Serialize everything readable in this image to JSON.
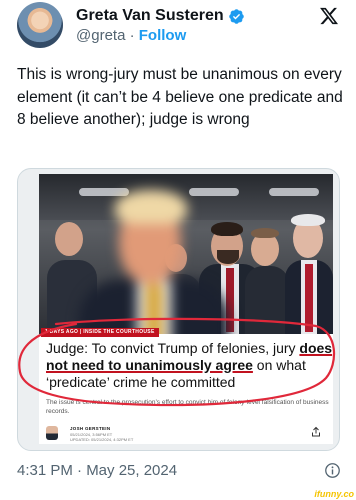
{
  "author": {
    "display_name": "Greta Van Susteren",
    "handle": "@greta",
    "separator": "·",
    "follow_label": "Follow",
    "verified": true
  },
  "tweet": {
    "text": "This is wrong-jury must be unanimous on every element (it can’t be 4 believe one predicate and 8 believe another); judge is wrong",
    "timestamp": "4:31 PM · May 25, 2024"
  },
  "article": {
    "kicker": "1 DAYS AGO | INSIDE THE COURTHOUSE",
    "headline_part1": "Judge: To convict Trump of felonies, jury ",
    "headline_bold": "does not need to unanimously agree",
    "headline_part2": " on what ‘predicate’ crime he committed",
    "subtext": "The issue is central to the prosecution’s effort to convict him of felony-level falsification of business records.",
    "author_name": "JOSH GERSTEIN",
    "published": "05/21/2024, 3:56PM ET",
    "updated": "UPDATED: 05/21/2024, 4:32PM ET"
  },
  "colors": {
    "accent": "#1d9bf0",
    "annotation_red": "#e0283a",
    "text_secondary": "#536471"
  },
  "icons": [
    "verified-badge-icon",
    "x-logo-icon",
    "share-icon",
    "info-icon"
  ],
  "watermark": "ifunny.co"
}
